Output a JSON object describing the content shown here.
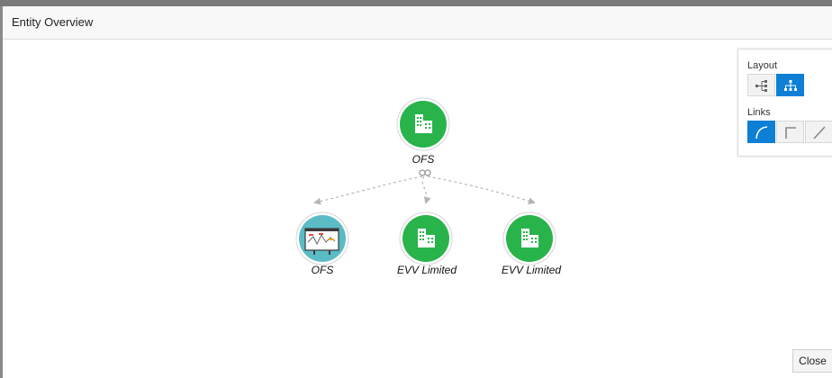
{
  "dialog": {
    "title": "Entity Overview",
    "close_label": "Close"
  },
  "graph": {
    "nodes": [
      {
        "label": "OFS",
        "icon": "building-icon",
        "color": "#28b44a"
      },
      {
        "label": "OFS",
        "icon": "chart-board-icon",
        "color": "#5bbcc6"
      },
      {
        "label": "EVV Limited",
        "icon": "building-icon",
        "color": "#28b44a"
      },
      {
        "label": "EVV Limited",
        "icon": "building-icon",
        "color": "#28b44a"
      }
    ]
  },
  "panel": {
    "layout_label": "Layout",
    "links_label": "Links",
    "layout_options": [
      "horizontal-tree-icon",
      "vertical-tree-icon"
    ],
    "layout_selected": "vertical-tree-icon",
    "link_options": [
      "curved-link-icon",
      "orthogonal-link-icon",
      "straight-link-icon"
    ],
    "link_selected": "curved-link-icon"
  },
  "colors": {
    "accent": "#0d7fd5",
    "entity_green": "#28b44a",
    "report_teal": "#5bbcc6"
  }
}
